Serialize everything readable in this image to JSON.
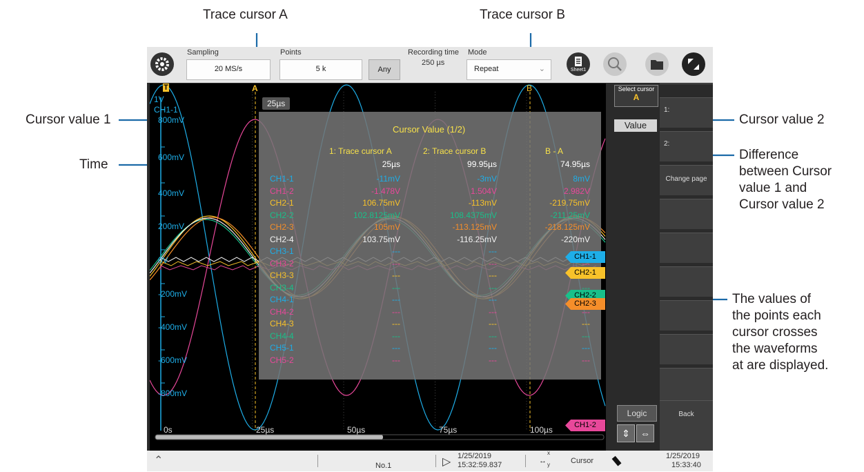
{
  "annotations": {
    "trace_cursor_a": "Trace cursor A",
    "trace_cursor_b": "Trace cursor B",
    "cursor_value_1": "Cursor value 1",
    "cursor_value_2": "Cursor value 2",
    "time": "Time",
    "difference": [
      "Difference",
      "between Cursor",
      "value 1 and",
      "Cursor value 2"
    ],
    "values_note": [
      "The values of",
      "the points each",
      "cursor crosses",
      "the waveforms",
      "at are displayed."
    ]
  },
  "toolbar": {
    "sampling_label": "Sampling",
    "sampling_value": "20 MS/s",
    "points_label": "Points",
    "points_value": "5 k",
    "any_button": "Any",
    "recording_label": "Recording time",
    "recording_value": "250 µs",
    "mode_label": "Mode",
    "mode_value": "Repeat",
    "sheet_label": "Sheet1"
  },
  "screen": {
    "trigger_mark": "T",
    "cursor_a_mark": "A",
    "cursor_b_mark": "B",
    "ch_scale": "1V",
    "ch_name": "CH1-1",
    "y_labels": [
      "800mV",
      "600mV",
      "400mV",
      "200mV",
      "0V",
      "-200mV",
      "-400mV",
      "-600mV",
      "-800mV"
    ],
    "x_labels": [
      "0s",
      "25µs",
      "50µs",
      "75µs",
      "100µs"
    ],
    "cursor_time_badge": "25µs"
  },
  "cursor_panel": {
    "title": "Cursor Value (1/2)",
    "col_a": "1: Trace cursor A",
    "col_b": "2: Trace cursor B",
    "col_diff": "B - A",
    "time_row": {
      "a": "25µs",
      "b": "99.95µs",
      "diff": "74.95µs"
    },
    "rows": [
      {
        "name": "CH1-1",
        "a": "-11mV",
        "b": "-3mV",
        "diff": "8mV",
        "color": "#1eaee8"
      },
      {
        "name": "CH1-2",
        "a": "-1.478V",
        "b": "1.504V",
        "diff": "2.982V",
        "color": "#e8489a"
      },
      {
        "name": "CH2-1",
        "a": "106.75mV",
        "b": "-113mV",
        "diff": "-219.75mV",
        "color": "#f8c22a"
      },
      {
        "name": "CH2-2",
        "a": "102.8125mV",
        "b": "108.4375mV",
        "diff": "-211.25mV",
        "color": "#19c08a"
      },
      {
        "name": "CH2-3",
        "a": "105mV",
        "b": "-113.125mV",
        "diff": "-218.125mV",
        "color": "#f58e2a"
      },
      {
        "name": "CH2-4",
        "a": "103.75mV",
        "b": "-116.25mV",
        "diff": "-220mV",
        "color": "#f2f2f2"
      },
      {
        "name": "CH3-1",
        "a": "---",
        "b": "---",
        "diff": "---",
        "color": "#1eaee8"
      },
      {
        "name": "CH3-2",
        "a": "---",
        "b": "---",
        "diff": "---",
        "color": "#e8489a"
      },
      {
        "name": "CH3-3",
        "a": "---",
        "b": "---",
        "diff": "---",
        "color": "#f8c22a"
      },
      {
        "name": "CH3-4",
        "a": "---",
        "b": "---",
        "diff": "---",
        "color": "#19c08a"
      },
      {
        "name": "CH4-1",
        "a": "---",
        "b": "---",
        "diff": "---",
        "color": "#1eaee8"
      },
      {
        "name": "CH4-2",
        "a": "---",
        "b": "---",
        "diff": "---",
        "color": "#e8489a"
      },
      {
        "name": "CH4-3",
        "a": "---",
        "b": "---",
        "diff": "---",
        "color": "#f8c22a"
      },
      {
        "name": "CH4-4",
        "a": "---",
        "b": "---",
        "diff": "---",
        "color": "#19c08a"
      },
      {
        "name": "CH5-1",
        "a": "---",
        "b": "---",
        "diff": "---",
        "color": "#1eaee8"
      },
      {
        "name": "CH5-2",
        "a": "---",
        "b": "---",
        "diff": "---",
        "color": "#e8489a"
      }
    ]
  },
  "channel_tags": [
    {
      "label": "CH1-1",
      "color": "#1eaee8"
    },
    {
      "label": "CH2-1",
      "color": "#f8c22a"
    },
    {
      "label": "CH2-2",
      "color": "#19c08a"
    },
    {
      "label": "CH2-3",
      "color": "#f58e2a"
    },
    {
      "label": "CH1-2",
      "color": "#e8489a"
    }
  ],
  "side": {
    "select_cursor": "Select cursor",
    "select_cursor_value": "A",
    "value_button": "Value",
    "logic_button": "Logic"
  },
  "fkeys": {
    "k1": "1:",
    "k2": "2:",
    "change_page": "Change page",
    "back": "Back"
  },
  "bottom": {
    "no": "No.1",
    "date1": "1/25/2019",
    "time1": "15:32:59.837",
    "cursor_label": "Cursor",
    "axis_x": "x",
    "axis_y": "y",
    "date2": "1/25/2019",
    "time2": "15:33:40"
  }
}
